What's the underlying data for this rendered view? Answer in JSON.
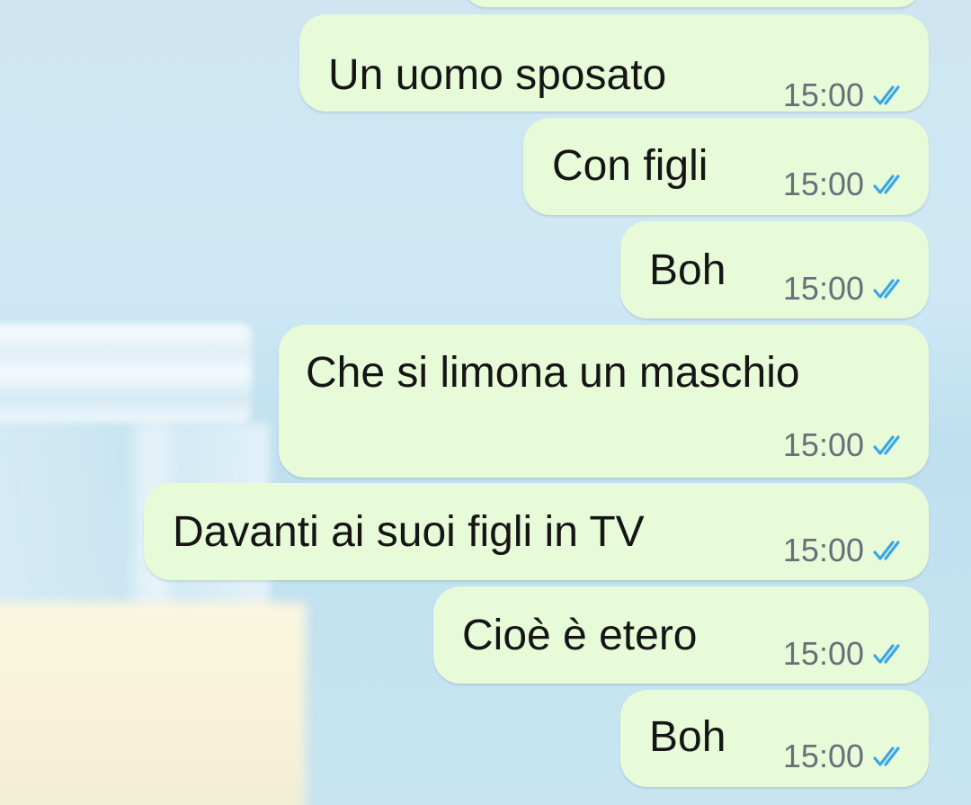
{
  "colors": {
    "bubble_outgoing": "#e7fbd8",
    "timestamp": "#67707a",
    "read_ticks": "#3aa6e8"
  },
  "messages": [
    {
      "text": "Un uomo sposato",
      "time": "15:00",
      "status_icon": "double-check-read-icon"
    },
    {
      "text": "Con figli",
      "time": "15:00",
      "status_icon": "double-check-read-icon"
    },
    {
      "text": "Boh",
      "time": "15:00",
      "status_icon": "double-check-read-icon"
    },
    {
      "text": "Che si limona un maschio",
      "time": "15:00",
      "status_icon": "double-check-read-icon"
    },
    {
      "text": "Davanti ai suoi figli in TV",
      "time": "15:00",
      "status_icon": "double-check-read-icon"
    },
    {
      "text": "Cioè è etero",
      "time": "15:00",
      "status_icon": "double-check-read-icon"
    },
    {
      "text": "Boh",
      "time": "15:00",
      "status_icon": "double-check-read-icon"
    }
  ]
}
